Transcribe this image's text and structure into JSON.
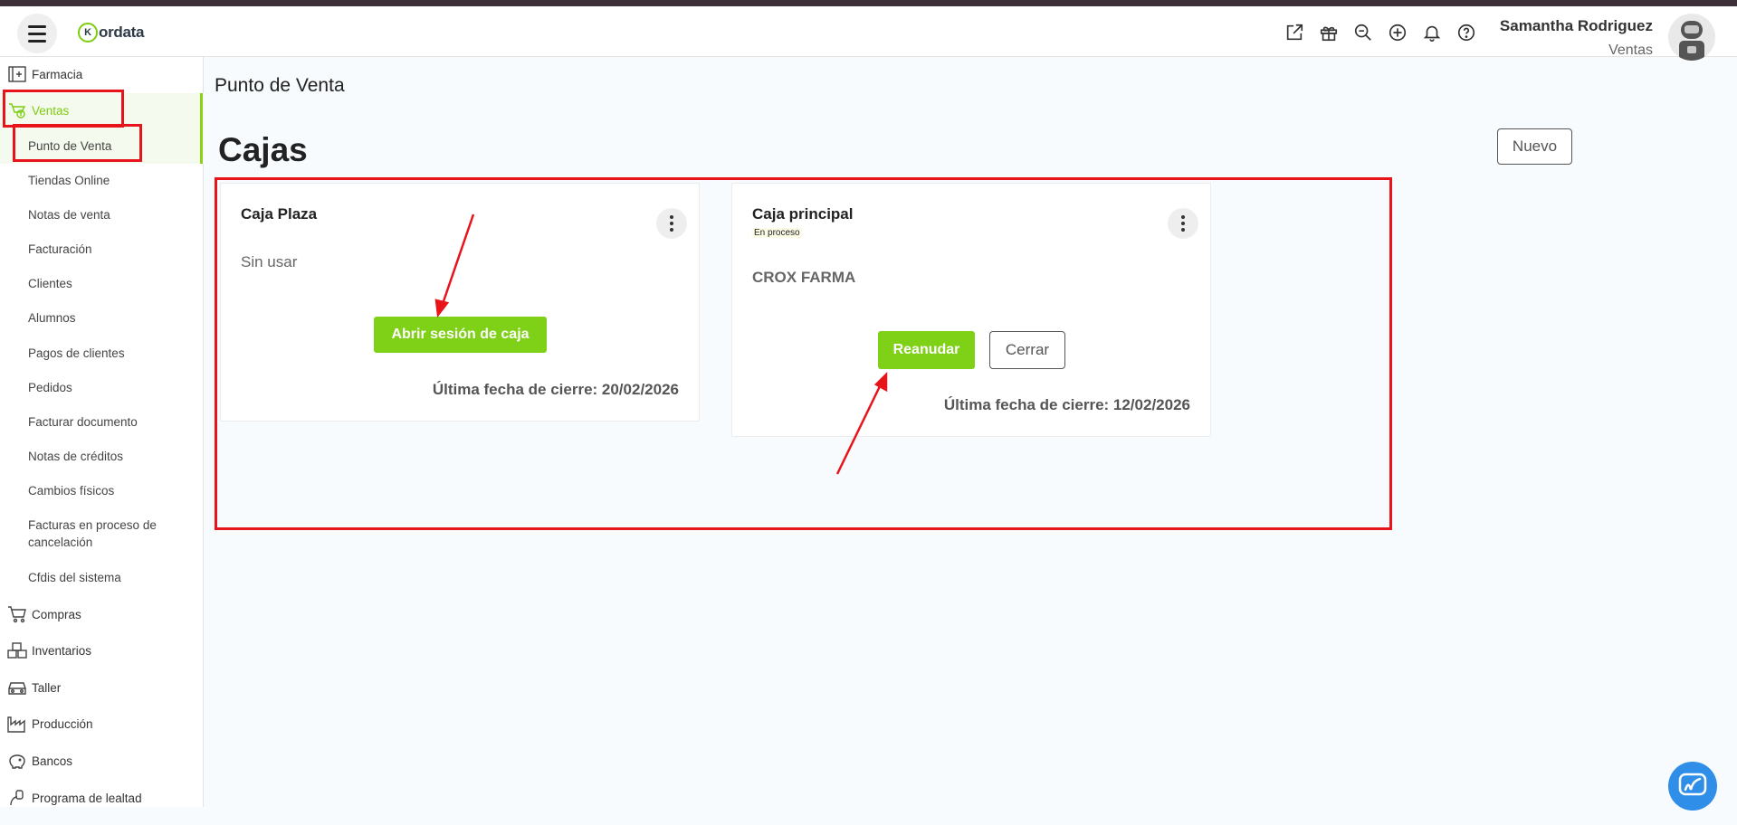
{
  "app": {
    "name": "ordata",
    "logo_letter": "K"
  },
  "header": {
    "user_name": "Samantha Rodriguez",
    "user_role": "Ventas",
    "icons": [
      "external-link-icon",
      "gift-icon",
      "search-zoom-icon",
      "plus-circle-icon",
      "bell-icon",
      "help-icon"
    ]
  },
  "sidebar": {
    "farmacia": "Farmacia",
    "ventas": "Ventas",
    "ventas_items": [
      "Punto de Venta",
      "Tiendas Online",
      "Notas de venta",
      "Facturación",
      "Clientes",
      "Alumnos",
      "Pagos de clientes",
      "Pedidos",
      "Facturar documento",
      "Notas de créditos",
      "Cambios físicos",
      "Facturas en proceso de cancelación",
      "Cfdis del sistema"
    ],
    "compras": "Compras",
    "inventarios": "Inventarios",
    "taller": "Taller",
    "produccion": "Producción",
    "bancos": "Bancos",
    "lealtad": "Programa de lealtad"
  },
  "main": {
    "breadcrumb": "Punto de Venta",
    "title": "Cajas",
    "new_button": "Nuevo",
    "cards": [
      {
        "name": "Caja Plaza",
        "status": "",
        "description": "Sin usar",
        "primary_button": "Abrir sesión de caja",
        "last_close": "Última fecha de cierre: 20/02/2026"
      },
      {
        "name": "Caja principal",
        "status": "En proceso",
        "description": "CROX FARMA",
        "primary_button": "Reanudar",
        "secondary_button": "Cerrar",
        "last_close": "Última fecha de cierre: 12/02/2026"
      }
    ]
  },
  "colors": {
    "accent": "#7fd117",
    "highlight": "#e8141b",
    "chat": "#2f8ee8"
  }
}
